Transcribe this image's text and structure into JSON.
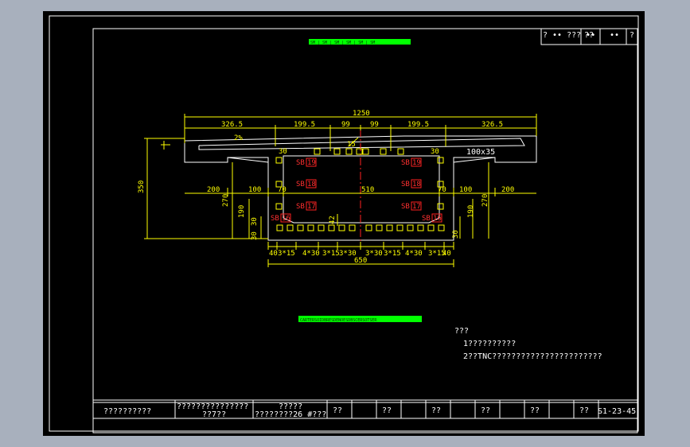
{
  "colors": {
    "window_bg": "#a8b0bd",
    "canvas": "#000000",
    "border": "#ffffff",
    "dimension": "#ffff00",
    "centerline": "#ff0000",
    "label_tag": "#00ff00"
  },
  "title_block_top": [
    "? •• ??? ••",
    "??",
    "••",
    "?"
  ],
  "green_bar_top": "SM | SM | SM | SM | SM | SM",
  "green_bar_bottom": "CARTERSOIDBRESDENOESDBSCERSOTSER",
  "dimensions": {
    "overall_width": "1250",
    "top_segments": [
      "326.5",
      "199.5",
      "99",
      "99",
      "199.5",
      "326.5"
    ],
    "height": "350",
    "left_flange": "200",
    "left_web": "100",
    "inner_width": "510",
    "right_web": "100",
    "right_flange": "200",
    "inner_height_left": "270",
    "inner_height_right": "270",
    "web_left_190": "190",
    "web_right_190": "190",
    "small_30_a": "30",
    "small_30_b": "30",
    "small_30_c": "30",
    "small_30_d": "30",
    "small_30_e": "30",
    "small_70_a": "70",
    "small_70_b": "70",
    "deck_slope": "2%",
    "tendon_spacing": [
      "40",
      "3*15",
      "4*30",
      "3*15",
      "3*30",
      "3*30",
      "3*15",
      "4*30",
      "3*15",
      "40"
    ],
    "bottom_width": "650",
    "top_tag": "15",
    "center_tag": "42",
    "note_right_top": "100x35"
  },
  "tendon_labels": {
    "left": [
      "SB",
      "SB",
      "SB",
      "SB"
    ],
    "right": [
      "SB",
      "SB",
      "SB",
      "SB"
    ],
    "left_nums": [
      "19",
      "18",
      "17",
      "16"
    ],
    "right_nums": [
      "19",
      "18",
      "17",
      "16"
    ]
  },
  "notes": {
    "heading": "???",
    "line1": "1??????????",
    "line2": "2??TNC???????????????????????"
  },
  "title_block_bottom": {
    "cell1": "??????????",
    "cell2_line1": "???????????????",
    "cell2_line2": "??7??",
    "cell3_line1": "?????",
    "cell3_line2": "????????26 #???",
    "cell4": "??",
    "cell5": "??",
    "cell6": "??",
    "cell7": "??",
    "cell8": "??",
    "cell9": "??",
    "drawing_no": "S1-23-45"
  }
}
